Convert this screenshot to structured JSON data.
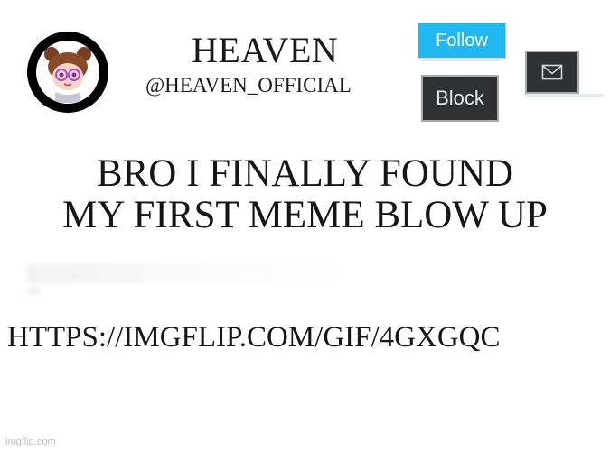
{
  "profile": {
    "display_name": "HEAVEN",
    "handle": "@HEAVEN_OFFICIAL",
    "avatar_icon": "avatar-icon"
  },
  "actions": {
    "follow_label": "Follow",
    "block_label": "Block",
    "message_icon": "mail-icon"
  },
  "post": {
    "line1": "BRO I FINALLY FOUND",
    "line2": "MY FIRST MEME BLOW UP",
    "link": "HTTPS://IMGFLIP.COM/GIF/4GXGQC"
  },
  "watermark": {
    "text": "imgflip.com"
  },
  "colors": {
    "follow_bg": "#1fb8f0",
    "dark_button_bg": "#2f3133",
    "text": "#161616",
    "background": "#ffffff"
  }
}
